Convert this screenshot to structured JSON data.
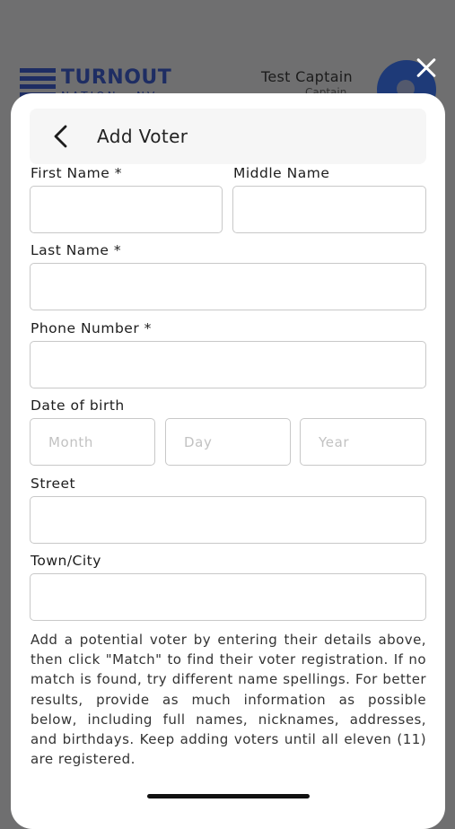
{
  "background": {
    "logo_title": "TURNOUT",
    "logo_subtitle": "NATION · NV",
    "user_name": "Test Captain",
    "user_role": "Captain"
  },
  "modal": {
    "title": "Add Voter",
    "fields": {
      "first_name": {
        "label": "First Name *",
        "value": ""
      },
      "middle_name": {
        "label": "Middle Name",
        "value": ""
      },
      "last_name": {
        "label": "Last Name *",
        "value": ""
      },
      "phone": {
        "label": "Phone Number *",
        "value": ""
      },
      "dob": {
        "label": "Date of birth",
        "month_placeholder": "Month",
        "day_placeholder": "Day",
        "year_placeholder": "Year"
      },
      "street": {
        "label": "Street",
        "value": ""
      },
      "city": {
        "label": "Town/City",
        "value": ""
      }
    },
    "help_text": "Add a potential voter by entering their details above, then click \"Match\" to find their voter registration. If no match is found, try different name spellings. For better results, provide as much information as possible below, including full names, nicknames, addresses, and birthdays. Keep adding voters until all eleven (11) are registered."
  },
  "colors": {
    "overlay": "#6f6f70",
    "brand_navy": "#1e2d63",
    "sheet": "#ffffff",
    "field_border": "#c8c8c8"
  },
  "icons": {
    "close": "close-icon",
    "back": "chevron-left-icon",
    "logo": "turnout-logo-icon"
  }
}
